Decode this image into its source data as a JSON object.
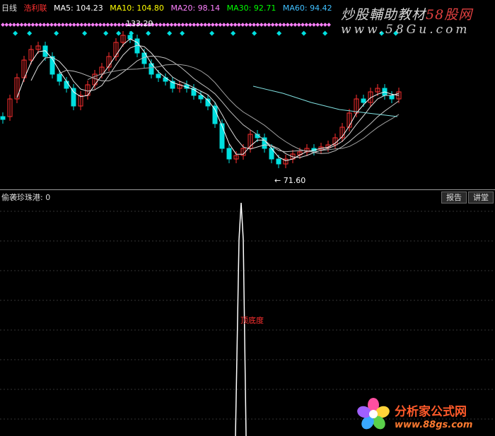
{
  "header": {
    "period": "日线",
    "stock": "浩利联",
    "ma5": "MA5: 104.23",
    "ma10": "MA10: 104.80",
    "ma20": "MA20: 98.14",
    "ma30": "MA30: 92.71",
    "ma60": "MA60: 94.42"
  },
  "colors": {
    "up": "#ff3030",
    "down": "#00e0e0",
    "ma5": "#ffffff",
    "ma10": "#ffff00",
    "ma20": "#ff80ff",
    "ma30": "#00ff00",
    "ma60": "#40c0ff",
    "marker": "#ff80ff",
    "marker_cyan": "#00e0e0"
  },
  "price_labels": {
    "high": "133.29",
    "low": "← 71.60"
  },
  "watermark": {
    "line1_a": "炒股輔助教材",
    "line1_b": "58股网",
    "line2": "www.58Gu.com"
  },
  "indicator": {
    "title": "偷袭珍珠港: 0",
    "buttons": [
      "报告",
      "讲堂"
    ],
    "signal_label": "顶底度"
  },
  "logo": {
    "name": "分析家公式网",
    "url": "www.88gs.com"
  },
  "chart_data": {
    "type": "candlestick",
    "series_label": "浩利联",
    "high_marker": 133.29,
    "low_marker": 71.6,
    "moving_averages": [
      {
        "name": "MA5",
        "value": 104.23
      },
      {
        "name": "MA10",
        "value": 104.8
      },
      {
        "name": "MA20",
        "value": 98.14
      },
      {
        "name": "MA30",
        "value": 92.71
      },
      {
        "name": "MA60",
        "value": 94.42
      }
    ],
    "indicator_value": 0
  }
}
